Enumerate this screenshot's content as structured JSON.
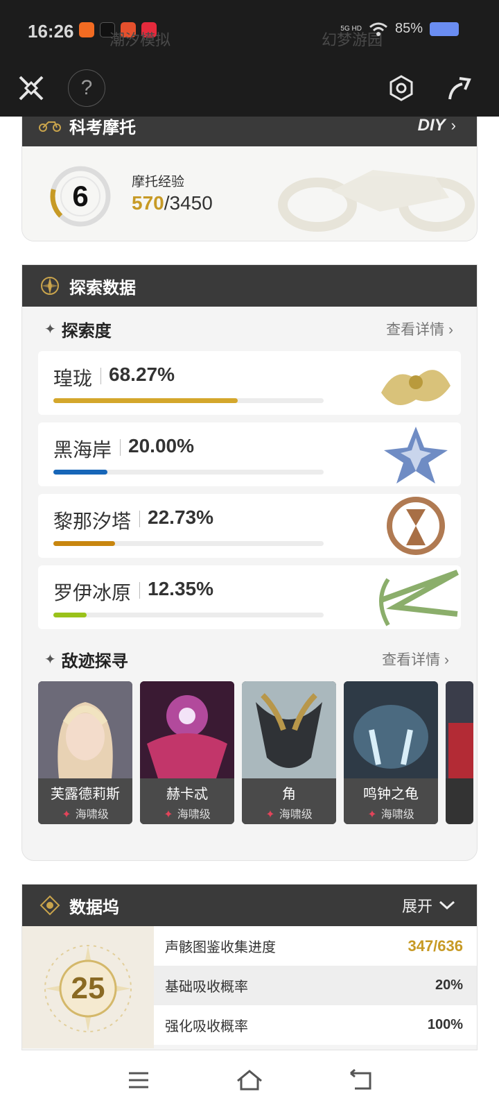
{
  "status": {
    "time": "16:26",
    "ghost_left": "潮汐模拟",
    "ghost_right": "幻梦游园",
    "network": "5G HD",
    "battery": "85%"
  },
  "topbar": {
    "help_label": "?"
  },
  "moto": {
    "title": "科考摩托",
    "diy_label": "DIY",
    "level": "6",
    "exp_label": "摩托经验",
    "exp_current": "570",
    "exp_total": "/3450",
    "exp_progress": 0.165
  },
  "explore": {
    "title": "探索数据",
    "section_title": "探索度",
    "details_label": "查看详情",
    "regions": [
      {
        "name": "瑝珑",
        "percent": "68.27%",
        "value": 68.27,
        "color": "#d4a72c"
      },
      {
        "name": "黑海岸",
        "percent": "20.00%",
        "value": 20.0,
        "color": "#1766b8"
      },
      {
        "name": "黎那汐塔",
        "percent": "22.73%",
        "value": 22.73,
        "color": "#c8860f"
      },
      {
        "name": "罗伊冰原",
        "percent": "12.35%",
        "value": 12.35,
        "color": "#9ac21a"
      }
    ],
    "boss_title": "敌迹探寻",
    "boss_details_label": "查看详情",
    "bosses": [
      {
        "name": "芙露德莉斯",
        "grade": "海啸级"
      },
      {
        "name": "赫卡忒",
        "grade": "海啸级"
      },
      {
        "name": "角",
        "grade": "海啸级"
      },
      {
        "name": "鸣钟之龟",
        "grade": "海啸级"
      }
    ]
  },
  "dock": {
    "title": "数据坞",
    "expand_label": "展开",
    "level": "25",
    "rows": [
      {
        "label": "声骸图鉴收集进度",
        "value": "347/636"
      },
      {
        "label": "基础吸收概率",
        "value": "20%"
      },
      {
        "label": "强化吸收概率",
        "value": "100%"
      }
    ]
  },
  "colors": {
    "accent": "#c79a25",
    "header": "#3a3a3a"
  }
}
